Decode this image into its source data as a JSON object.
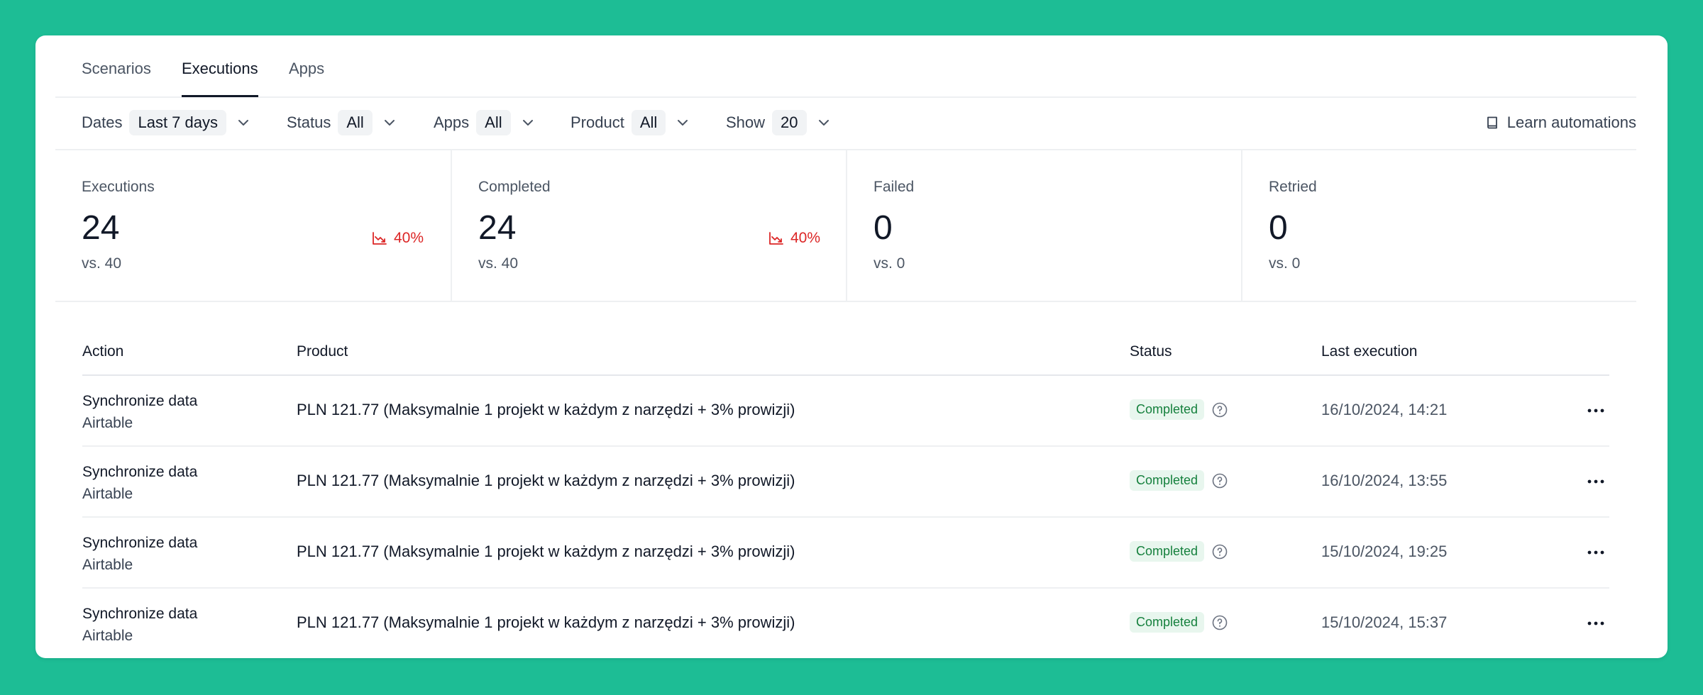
{
  "tabs": [
    {
      "label": "Scenarios",
      "active": false
    },
    {
      "label": "Executions",
      "active": true
    },
    {
      "label": "Apps",
      "active": false
    }
  ],
  "filters": {
    "dates": {
      "label": "Dates",
      "value": "Last 7 days"
    },
    "status": {
      "label": "Status",
      "value": "All"
    },
    "apps": {
      "label": "Apps",
      "value": "All"
    },
    "product": {
      "label": "Product",
      "value": "All"
    },
    "show": {
      "label": "Show",
      "value": "20"
    },
    "learn_label": "Learn automations"
  },
  "stats": [
    {
      "label": "Executions",
      "value": "24",
      "comparison": "vs. 40",
      "trend": "40%"
    },
    {
      "label": "Completed",
      "value": "24",
      "comparison": "vs. 40",
      "trend": "40%"
    },
    {
      "label": "Failed",
      "value": "0",
      "comparison": "vs. 0",
      "trend": ""
    },
    {
      "label": "Retried",
      "value": "0",
      "comparison": "vs. 0",
      "trend": ""
    }
  ],
  "colors": {
    "background": "#1dbd95",
    "trend_down": "#dc2626",
    "badge_bg": "#e8f6ee",
    "badge_text": "#15803d"
  },
  "table": {
    "headers": {
      "action": "Action",
      "product": "Product",
      "status": "Status",
      "last_execution": "Last execution"
    },
    "rows": [
      {
        "action": "Synchronize data",
        "app": "Airtable",
        "product": "PLN 121.77 (Maksymalnie 1 projekt w każdym z narzędzi + 3% prowizji)",
        "status": "Completed",
        "last_execution": "16/10/2024, 14:21"
      },
      {
        "action": "Synchronize data",
        "app": "Airtable",
        "product": "PLN 121.77 (Maksymalnie 1 projekt w każdym z narzędzi + 3% prowizji)",
        "status": "Completed",
        "last_execution": "16/10/2024, 13:55"
      },
      {
        "action": "Synchronize data",
        "app": "Airtable",
        "product": "PLN 121.77 (Maksymalnie 1 projekt w każdym z narzędzi + 3% prowizji)",
        "status": "Completed",
        "last_execution": "15/10/2024, 19:25"
      },
      {
        "action": "Synchronize data",
        "app": "Airtable",
        "product": "PLN 121.77 (Maksymalnie 1 projekt w każdym z narzędzi + 3% prowizji)",
        "status": "Completed",
        "last_execution": "15/10/2024, 15:37"
      }
    ]
  }
}
